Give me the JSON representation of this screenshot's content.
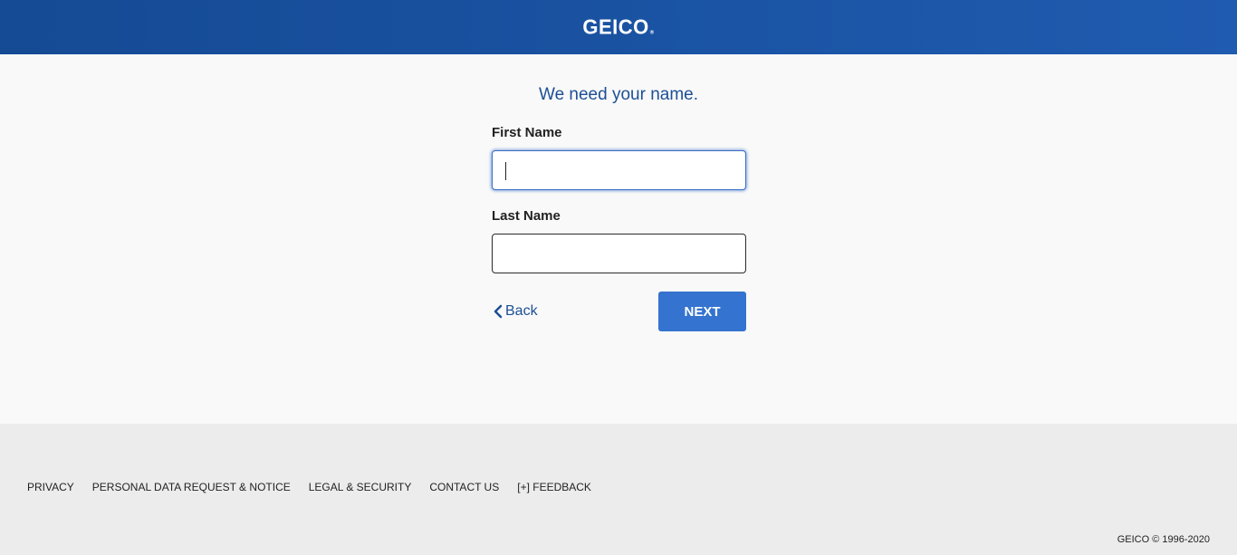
{
  "header": {
    "logo_text": "GEICO",
    "logo_reg": "®",
    "brand_color": "#1f5bb0"
  },
  "form": {
    "title": "We need your name.",
    "first_name_label": "First Name",
    "first_name_value": "",
    "last_name_label": "Last Name",
    "last_name_value": "",
    "back_label": "Back",
    "next_label": "NEXT",
    "accent_color": "#3473cf"
  },
  "footer": {
    "links": [
      "PRIVACY",
      "PERSONAL DATA REQUEST & NOTICE",
      "LEGAL & SECURITY",
      "CONTACT US",
      "[+] FEEDBACK"
    ],
    "copyright": "GEICO © 1996-2020"
  }
}
